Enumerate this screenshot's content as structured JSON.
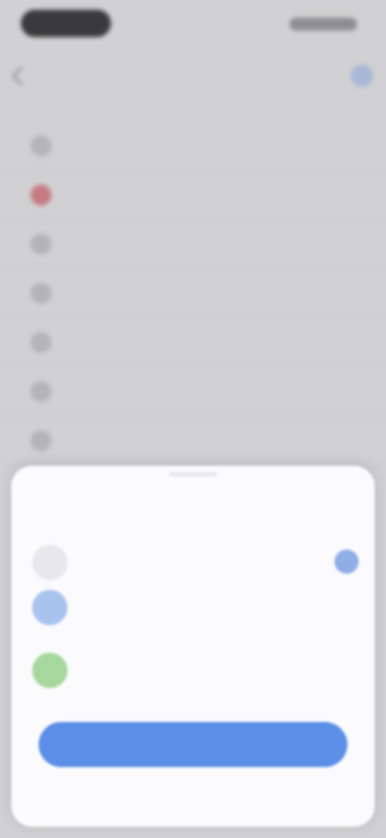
{
  "colors": {
    "screen_background": "#d1d1d3",
    "sheet_background": "#fbfbfd",
    "accent_blue": "#5b8ee6",
    "destructive_red": "#c67a82",
    "avatar_blue": "#a9c3ef",
    "avatar_green": "#a6d79d"
  },
  "icons": {
    "back": "chevron-left-icon",
    "nav_action": "more-icon",
    "selected": "checkmark-icon"
  },
  "navigation": {
    "title": ""
  },
  "menu": {
    "items": [
      {
        "label": "",
        "icon": "circle-icon",
        "emphasis": true
      },
      {
        "label": "",
        "icon": "alert-icon",
        "emphasis": false
      },
      {
        "label": "",
        "icon": "circle-icon",
        "emphasis": false
      },
      {
        "label": "",
        "icon": "circle-icon",
        "emphasis": false
      },
      {
        "label": "",
        "icon": "circle-icon",
        "emphasis": false
      },
      {
        "label": "",
        "icon": "circle-icon",
        "emphasis": true
      },
      {
        "label": "",
        "icon": "circle-icon",
        "emphasis": false
      }
    ]
  },
  "sheet": {
    "title": "",
    "options": [
      {
        "label": "",
        "selected": true
      },
      {
        "label": "",
        "selected": false
      },
      {
        "label": "",
        "selected": false
      }
    ],
    "primary_button_label": ""
  }
}
